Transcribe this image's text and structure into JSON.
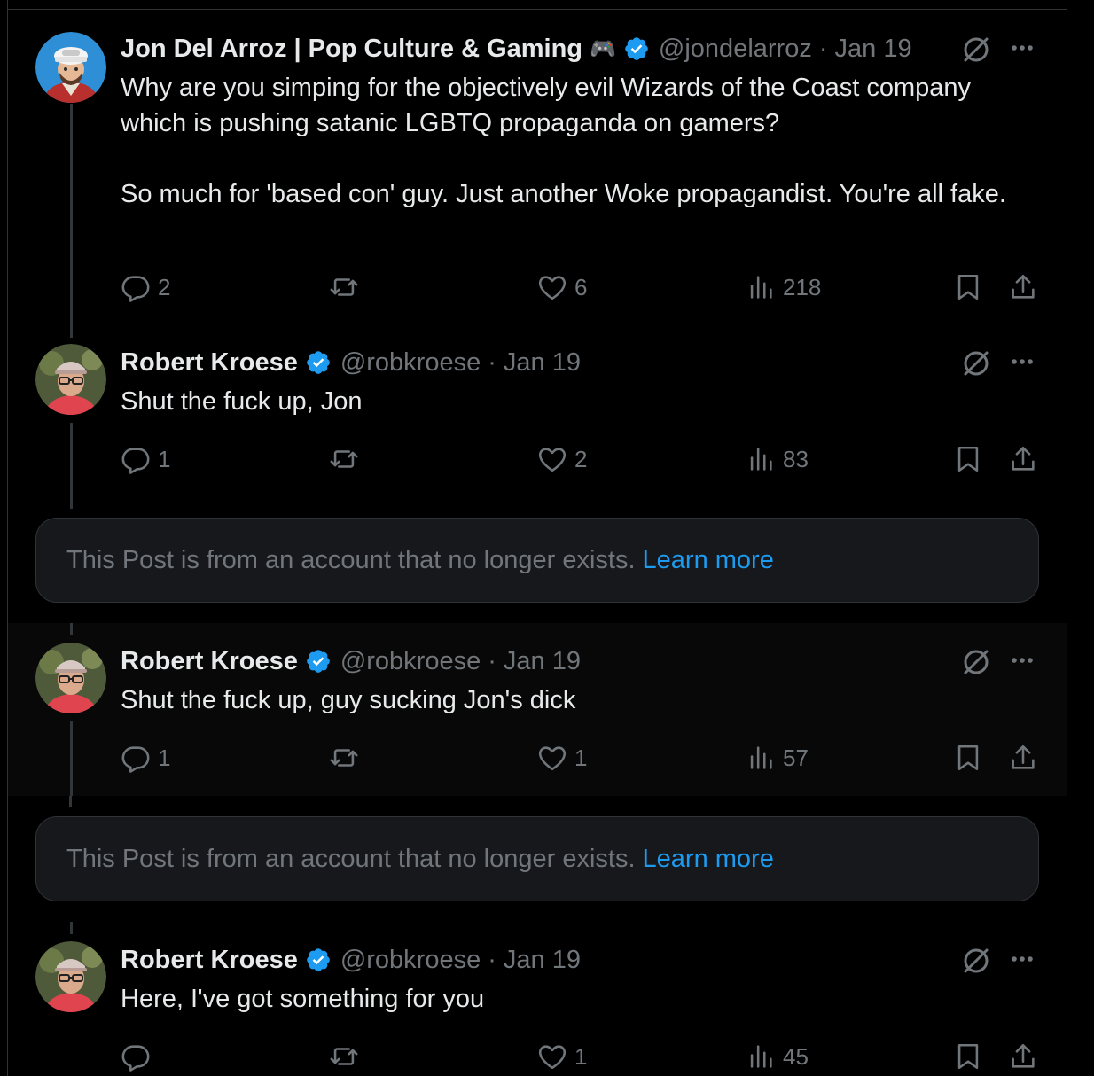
{
  "posts": [
    {
      "name": "Jon Del Arroz | Pop Culture & Gaming",
      "emoji": "🎮",
      "handle": "@jondelarroz",
      "date": "Jan 19",
      "text": "Why are you simping for the objectively evil Wizards of the Coast company which is pushing satanic LGBTQ propaganda on gamers?\n\nSo much for 'based con' guy. Just another Woke propagandist. You're all fake.",
      "replies": "2",
      "reposts": "",
      "likes": "6",
      "views": "218"
    },
    {
      "name": "Robert Kroese",
      "handle": "@robkroese",
      "date": "Jan 19",
      "text": "Shut the fuck up, Jon",
      "replies": "1",
      "reposts": "",
      "likes": "2",
      "views": "83"
    },
    {
      "name": "Robert Kroese",
      "handle": "@robkroese",
      "date": "Jan 19",
      "text": "Shut the fuck up, guy sucking Jon's dick",
      "replies": "1",
      "reposts": "",
      "likes": "1",
      "views": "57"
    },
    {
      "name": "Robert Kroese",
      "handle": "@robkroese",
      "date": "Jan 19",
      "text": "Here, I've got something for you",
      "replies": "",
      "reposts": "",
      "likes": "1",
      "views": "45"
    }
  ],
  "deleted_notice": {
    "message": "This Post is from an account that no longer exists.",
    "link": "Learn more"
  },
  "separator": "·",
  "colors": {
    "background": "#000000",
    "text": "#e7e9ea",
    "muted": "#71767b",
    "link": "#1d9bf0",
    "verified": "#1d9bf0"
  }
}
